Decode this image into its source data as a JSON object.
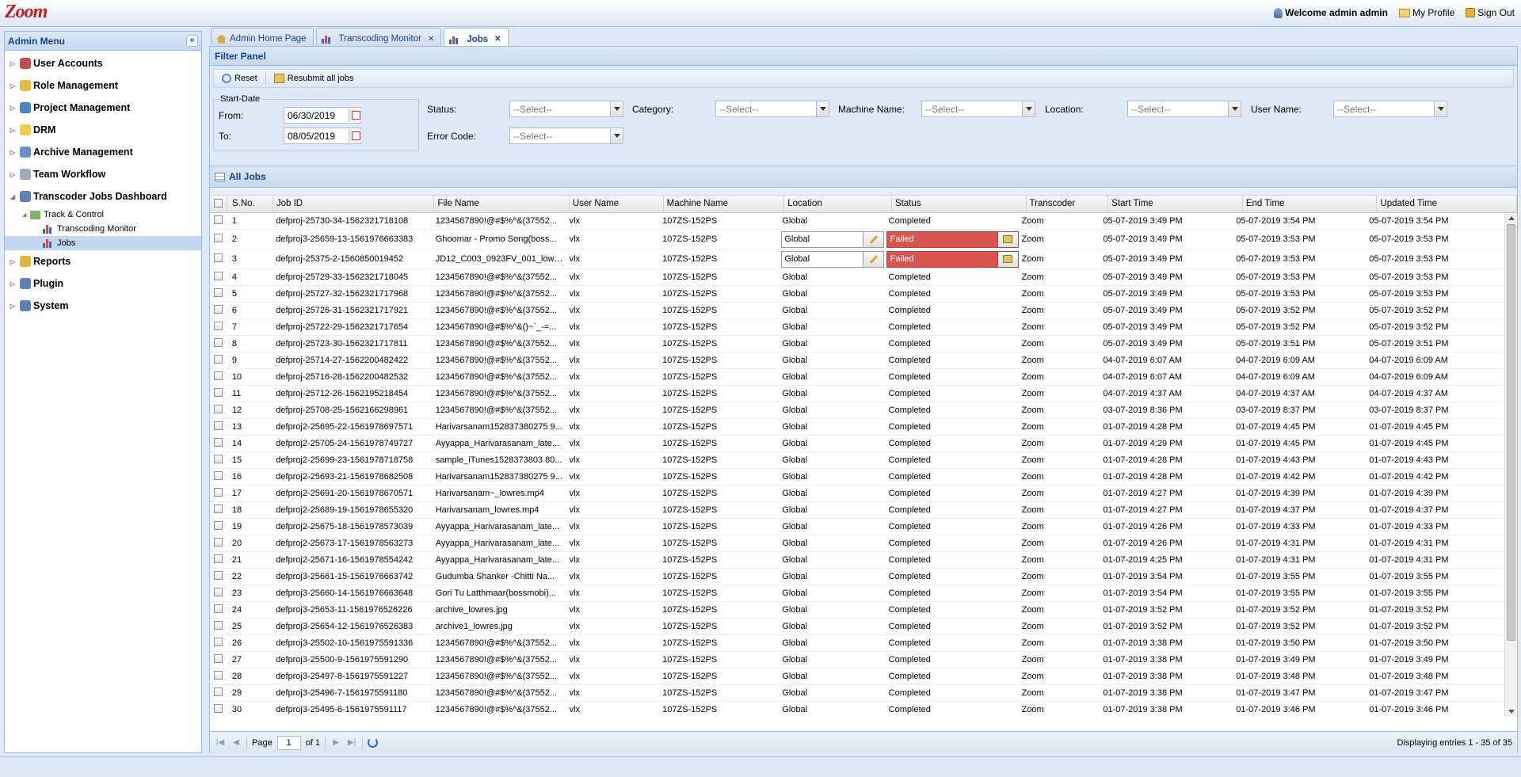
{
  "app": {
    "logo": "Zoom",
    "welcome": "Welcome admin admin",
    "my_profile": "My Profile",
    "sign_out": "Sign Out"
  },
  "sidebar": {
    "title": "Admin Menu",
    "collapse": "«",
    "items": [
      {
        "label": "User Accounts",
        "icon": "users-icon",
        "color": "#c0504d"
      },
      {
        "label": "Role Management",
        "icon": "shield-icon",
        "color": "#e5b843"
      },
      {
        "label": "Project Management",
        "icon": "globe-icon",
        "color": "#4a86c5"
      },
      {
        "label": "DRM",
        "icon": "folder-icon",
        "color": "#f0c94f"
      },
      {
        "label": "Archive Management",
        "icon": "archive-icon",
        "color": "#6a8fc7"
      },
      {
        "label": "Team Workflow",
        "icon": "workflow-icon",
        "color": "#9fa9b8"
      },
      {
        "label": "Transcoder Jobs Dashboard",
        "icon": "dashboard-icon",
        "color": "#5f7fb7"
      },
      {
        "label": "Reports",
        "icon": "reports-icon",
        "color": "#e2b53a"
      },
      {
        "label": "Plugin",
        "icon": "plugin-icon",
        "color": "#5f7fb7"
      },
      {
        "label": "System",
        "icon": "system-icon",
        "color": "#5f7fb7"
      }
    ],
    "sub": {
      "track_control": "Track & Control",
      "transcoding_monitor": "Transcoding Monitor",
      "jobs": "Jobs"
    }
  },
  "tabs": [
    {
      "label": "Admin Home Page"
    },
    {
      "label": "Transcoding Monitor"
    },
    {
      "label": "Jobs"
    }
  ],
  "filter": {
    "title": "Filter Panel",
    "reset": "Reset",
    "resubmit": "Resubmit all jobs",
    "start_date_label": "Start-Date",
    "from_label": "From:",
    "from_value": "06/30/2019",
    "to_label": "To:",
    "to_value": "08/05/2019",
    "status_label": "Status:",
    "category_label": "Category:",
    "machine_label": "Machine Name:",
    "location_label": "Location:",
    "user_label": "User Name:",
    "error_label": "Error Code:",
    "select_placeholder": "--Select--"
  },
  "grid": {
    "title": "All Jobs",
    "columns": [
      "S.No.",
      "Job ID",
      "File Name",
      "User Name",
      "Machine Name",
      "Location",
      "Status",
      "Transcoder",
      "Start Time",
      "End Time",
      "Updated Time"
    ],
    "edit_location_value": "Global",
    "failed_label": "Failed",
    "rows": [
      {
        "sno": "1",
        "job": "defproj-25730-34-1562321718108",
        "file": "1234567890!@#$%^&(37552...",
        "user": "vlx",
        "machine": "107ZS-152PS",
        "loc": "Global",
        "status": "Completed",
        "trans": "Zoom",
        "start": "05-07-2019 3:49 PM",
        "end": "05-07-2019 3:54 PM",
        "upd": "05-07-2019 3:54 PM"
      },
      {
        "sno": "2",
        "job": "defproj3-25659-13-1561976663383",
        "file": "Ghoomar - Promo Song(boss...",
        "user": "vlx",
        "machine": "107ZS-152PS",
        "loc": "Global",
        "status": "Failed",
        "trans": "Zoom",
        "start": "05-07-2019 3:49 PM",
        "end": "05-07-2019 3:53 PM",
        "upd": "05-07-2019 3:53 PM"
      },
      {
        "sno": "3",
        "job": "defproj-25375-2-1560850019452",
        "file": "JD12_C003_0923FV_001_lowre...",
        "user": "vlx",
        "machine": "107ZS-152PS",
        "loc": "Global",
        "status": "Failed",
        "trans": "Zoom",
        "start": "05-07-2019 3:49 PM",
        "end": "05-07-2019 3:53 PM",
        "upd": "05-07-2019 3:53 PM"
      },
      {
        "sno": "4",
        "job": "defproj-25729-33-1562321718045",
        "file": "1234567890!@#$%^&(37552...",
        "user": "vlx",
        "machine": "107ZS-152PS",
        "loc": "Global",
        "status": "Completed",
        "trans": "Zoom",
        "start": "05-07-2019 3:49 PM",
        "end": "05-07-2019 3:53 PM",
        "upd": "05-07-2019 3:53 PM"
      },
      {
        "sno": "5",
        "job": "defproj-25727-32-1562321717968",
        "file": "1234567890!@#$%^&(37552...",
        "user": "vlx",
        "machine": "107ZS-152PS",
        "loc": "Global",
        "status": "Completed",
        "trans": "Zoom",
        "start": "05-07-2019 3:49 PM",
        "end": "05-07-2019 3:53 PM",
        "upd": "05-07-2019 3:53 PM"
      },
      {
        "sno": "6",
        "job": "defproj-25726-31-1562321717921",
        "file": "1234567890!@#$%^&(37552...",
        "user": "vlx",
        "machine": "107ZS-152PS",
        "loc": "Global",
        "status": "Completed",
        "trans": "Zoom",
        "start": "05-07-2019 3:49 PM",
        "end": "05-07-2019 3:52 PM",
        "upd": "05-07-2019 3:52 PM"
      },
      {
        "sno": "7",
        "job": "defproj-25722-29-1562321717654",
        "file": "1234567890!@#$%^&()~`_-=...",
        "user": "vlx",
        "machine": "107ZS-152PS",
        "loc": "Global",
        "status": "Completed",
        "trans": "Zoom",
        "start": "05-07-2019 3:49 PM",
        "end": "05-07-2019 3:52 PM",
        "upd": "05-07-2019 3:52 PM"
      },
      {
        "sno": "8",
        "job": "defproj-25723-30-1562321717811",
        "file": "1234567890!@#$%^&(37552...",
        "user": "vlx",
        "machine": "107ZS-152PS",
        "loc": "Global",
        "status": "Completed",
        "trans": "Zoom",
        "start": "05-07-2019 3:49 PM",
        "end": "05-07-2019 3:51 PM",
        "upd": "05-07-2019 3:51 PM"
      },
      {
        "sno": "9",
        "job": "defproj-25714-27-1562200482422",
        "file": "1234567890!@#$%^&(37552...",
        "user": "vlx",
        "machine": "107ZS-152PS",
        "loc": "Global",
        "status": "Completed",
        "trans": "Zoom",
        "start": "04-07-2019 6:07 AM",
        "end": "04-07-2019 6:09 AM",
        "upd": "04-07-2019 6:09 AM"
      },
      {
        "sno": "10",
        "job": "defproj-25716-28-1562200482532",
        "file": "1234567890!@#$%^&(37552...",
        "user": "vlx",
        "machine": "107ZS-152PS",
        "loc": "Global",
        "status": "Completed",
        "trans": "Zoom",
        "start": "04-07-2019 6:07 AM",
        "end": "04-07-2019 6:09 AM",
        "upd": "04-07-2019 6:09 AM"
      },
      {
        "sno": "11",
        "job": "defproj-25712-26-1562195218454",
        "file": "1234567890!@#$%^&(37552...",
        "user": "vlx",
        "machine": "107ZS-152PS",
        "loc": "Global",
        "status": "Completed",
        "trans": "Zoom",
        "start": "04-07-2019 4:37 AM",
        "end": "04-07-2019 4:37 AM",
        "upd": "04-07-2019 4:37 AM"
      },
      {
        "sno": "12",
        "job": "defproj-25708-25-1562166298961",
        "file": "1234567890!@#$%^&(37552...",
        "user": "vlx",
        "machine": "107ZS-152PS",
        "loc": "Global",
        "status": "Completed",
        "trans": "Zoom",
        "start": "03-07-2019 8:36 PM",
        "end": "03-07-2019 8:37 PM",
        "upd": "03-07-2019 8:37 PM"
      },
      {
        "sno": "13",
        "job": "defproj2-25695-22-1561978697571",
        "file": "Harivarsanam152837380275 9...",
        "user": "vlx",
        "machine": "107ZS-152PS",
        "loc": "Global",
        "status": "Completed",
        "trans": "Zoom",
        "start": "01-07-2019 4:28 PM",
        "end": "01-07-2019 4:45 PM",
        "upd": "01-07-2019 4:45 PM"
      },
      {
        "sno": "14",
        "job": "defproj2-25705-24-1561978749727",
        "file": "Ayyappa_Harivarasanam_late...",
        "user": "vlx",
        "machine": "107ZS-152PS",
        "loc": "Global",
        "status": "Completed",
        "trans": "Zoom",
        "start": "01-07-2019 4:29 PM",
        "end": "01-07-2019 4:45 PM",
        "upd": "01-07-2019 4:45 PM"
      },
      {
        "sno": "15",
        "job": "defproj2-25699-23-1561978718758",
        "file": "sample_iTunes1528373803 80...",
        "user": "vlx",
        "machine": "107ZS-152PS",
        "loc": "Global",
        "status": "Completed",
        "trans": "Zoom",
        "start": "01-07-2019 4:28 PM",
        "end": "01-07-2019 4:43 PM",
        "upd": "01-07-2019 4:43 PM"
      },
      {
        "sno": "16",
        "job": "defproj2-25693-21-1561978682508",
        "file": "Harivarsanam152837380275 9...",
        "user": "vlx",
        "machine": "107ZS-152PS",
        "loc": "Global",
        "status": "Completed",
        "trans": "Zoom",
        "start": "01-07-2019 4:28 PM",
        "end": "01-07-2019 4:42 PM",
        "upd": "01-07-2019 4:42 PM"
      },
      {
        "sno": "17",
        "job": "defproj2-25691-20-1561978670571",
        "file": "Harivarsanam~_lowres.mp4",
        "user": "vlx",
        "machine": "107ZS-152PS",
        "loc": "Global",
        "status": "Completed",
        "trans": "Zoom",
        "start": "01-07-2019 4:27 PM",
        "end": "01-07-2019 4:39 PM",
        "upd": "01-07-2019 4:39 PM"
      },
      {
        "sno": "18",
        "job": "defproj2-25689-19-1561978655320",
        "file": "Harivarsanam_lowres.mp4",
        "user": "vlx",
        "machine": "107ZS-152PS",
        "loc": "Global",
        "status": "Completed",
        "trans": "Zoom",
        "start": "01-07-2019 4:27 PM",
        "end": "01-07-2019 4:37 PM",
        "upd": "01-07-2019 4:37 PM"
      },
      {
        "sno": "19",
        "job": "defproj2-25675-18-1561978573039",
        "file": "Ayyappa_Harivarasanam_late...",
        "user": "vlx",
        "machine": "107ZS-152PS",
        "loc": "Global",
        "status": "Completed",
        "trans": "Zoom",
        "start": "01-07-2019 4:26 PM",
        "end": "01-07-2019 4:33 PM",
        "upd": "01-07-2019 4:33 PM"
      },
      {
        "sno": "20",
        "job": "defproj2-25673-17-1561978563273",
        "file": "Ayyappa_Harivarasanam_late...",
        "user": "vlx",
        "machine": "107ZS-152PS",
        "loc": "Global",
        "status": "Completed",
        "trans": "Zoom",
        "start": "01-07-2019 4:26 PM",
        "end": "01-07-2019 4:31 PM",
        "upd": "01-07-2019 4:31 PM"
      },
      {
        "sno": "21",
        "job": "defproj2-25671-16-1561978554242",
        "file": "Ayyappa_Harivarasanam_late...",
        "user": "vlx",
        "machine": "107ZS-152PS",
        "loc": "Global",
        "status": "Completed",
        "trans": "Zoom",
        "start": "01-07-2019 4:25 PM",
        "end": "01-07-2019 4:31 PM",
        "upd": "01-07-2019 4:31 PM"
      },
      {
        "sno": "22",
        "job": "defproj3-25661-15-1561976663742",
        "file": "Gudumba Shanker -Chitti Na...",
        "user": "vlx",
        "machine": "107ZS-152PS",
        "loc": "Global",
        "status": "Completed",
        "trans": "Zoom",
        "start": "01-07-2019 3:54 PM",
        "end": "01-07-2019 3:55 PM",
        "upd": "01-07-2019 3:55 PM"
      },
      {
        "sno": "23",
        "job": "defproj3-25660-14-1561976663648",
        "file": "Gori Tu Latthmaar(bossmobi)...",
        "user": "vlx",
        "machine": "107ZS-152PS",
        "loc": "Global",
        "status": "Completed",
        "trans": "Zoom",
        "start": "01-07-2019 3:54 PM",
        "end": "01-07-2019 3:55 PM",
        "upd": "01-07-2019 3:55 PM"
      },
      {
        "sno": "24",
        "job": "defproj3-25653-11-1561976526226",
        "file": "archive_lowres.jpg",
        "user": "vlx",
        "machine": "107ZS-152PS",
        "loc": "Global",
        "status": "Completed",
        "trans": "Zoom",
        "start": "01-07-2019 3:52 PM",
        "end": "01-07-2019 3:52 PM",
        "upd": "01-07-2019 3:52 PM"
      },
      {
        "sno": "25",
        "job": "defproj3-25654-12-1561976526383",
        "file": "archive1_lowres.jpg",
        "user": "vlx",
        "machine": "107ZS-152PS",
        "loc": "Global",
        "status": "Completed",
        "trans": "Zoom",
        "start": "01-07-2019 3:52 PM",
        "end": "01-07-2019 3:52 PM",
        "upd": "01-07-2019 3:52 PM"
      },
      {
        "sno": "26",
        "job": "defproj3-25502-10-1561975591336",
        "file": "1234567890!@#$%^&(37552...",
        "user": "vlx",
        "machine": "107ZS-152PS",
        "loc": "Global",
        "status": "Completed",
        "trans": "Zoom",
        "start": "01-07-2019 3:38 PM",
        "end": "01-07-2019 3:50 PM",
        "upd": "01-07-2019 3:50 PM"
      },
      {
        "sno": "27",
        "job": "defproj3-25500-9-1561975591290",
        "file": "1234567890!@#$%^&(37552...",
        "user": "vlx",
        "machine": "107ZS-152PS",
        "loc": "Global",
        "status": "Completed",
        "trans": "Zoom",
        "start": "01-07-2019 3:38 PM",
        "end": "01-07-2019 3:49 PM",
        "upd": "01-07-2019 3:49 PM"
      },
      {
        "sno": "28",
        "job": "defproj3-25497-8-1561975591227",
        "file": "1234567890!@#$%^&(37552...",
        "user": "vlx",
        "machine": "107ZS-152PS",
        "loc": "Global",
        "status": "Completed",
        "trans": "Zoom",
        "start": "01-07-2019 3:38 PM",
        "end": "01-07-2019 3:48 PM",
        "upd": "01-07-2019 3:48 PM"
      },
      {
        "sno": "29",
        "job": "defproj3-25496-7-1561975591180",
        "file": "1234567890!@#$%^&(37552...",
        "user": "vlx",
        "machine": "107ZS-152PS",
        "loc": "Global",
        "status": "Completed",
        "trans": "Zoom",
        "start": "01-07-2019 3:38 PM",
        "end": "01-07-2019 3:47 PM",
        "upd": "01-07-2019 3:47 PM"
      },
      {
        "sno": "30",
        "job": "defproj3-25495-6-1561975591117",
        "file": "1234567890!@#$%^&(37552...",
        "user": "vlx",
        "machine": "107ZS-152PS",
        "loc": "Global",
        "status": "Completed",
        "trans": "Zoom",
        "start": "01-07-2019 3:38 PM",
        "end": "01-07-2019 3:46 PM",
        "upd": "01-07-2019 3:46 PM"
      }
    ]
  },
  "paging": {
    "page_label": "Page",
    "page_value": "1",
    "of_label": "of 1",
    "displaying": "Displaying entries 1 - 35 of 35"
  },
  "colors": {
    "header_text": "#15428b",
    "failed_bg": "#d9534f",
    "border": "#99bbe8"
  }
}
